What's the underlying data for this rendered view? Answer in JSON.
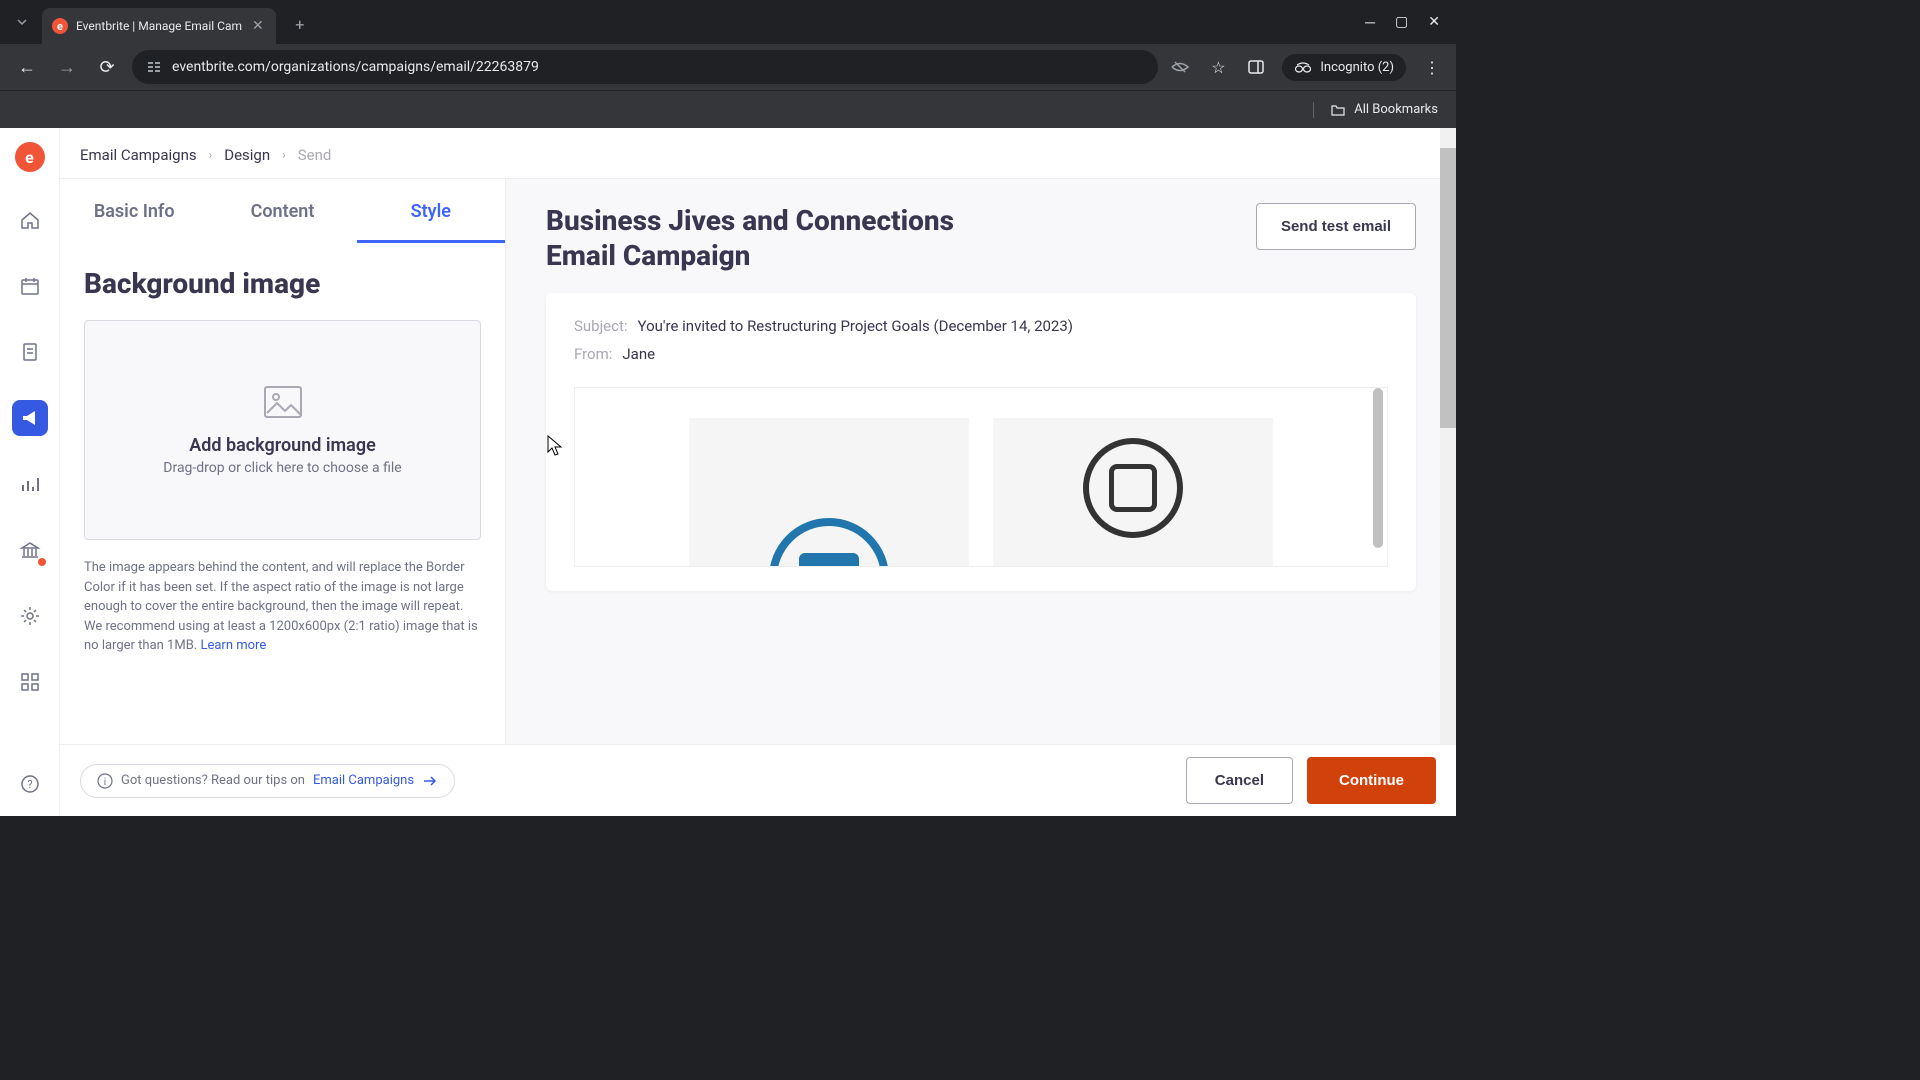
{
  "browser": {
    "tab_title": "Eventbrite | Manage Email Cam",
    "url": "eventbrite.com/organizations/campaigns/email/22263879",
    "incognito": "Incognito (2)",
    "all_bookmarks": "All Bookmarks"
  },
  "breadcrumbs": {
    "item1": "Email Campaigns",
    "item2": "Design",
    "item3": "Send"
  },
  "tabs": {
    "basic": "Basic Info",
    "content": "Content",
    "style": "Style"
  },
  "panel": {
    "heading": "Background image",
    "upload_title": "Add background image",
    "upload_sub": "Drag-drop or click here to choose a file",
    "help_text": "The image appears behind the content, and will replace the Border Color if it has been set. If the aspect ratio of the image is not large enough to cover the entire background, then the image will repeat. We recommend using at least a 1200x600px (2:1 ratio) image that is no larger than 1MB. ",
    "learn_more": "Learn more"
  },
  "preview": {
    "title": "Business Jives and Connections Email Campaign",
    "test_btn": "Send test email",
    "subject_label": "Subject:",
    "subject_value": "You're invited to Restructuring Project Goals (December 14, 2023)",
    "from_label": "From:",
    "from_value": "Jane"
  },
  "footer": {
    "help_text": "Got questions? Read our tips on ",
    "help_link": "Email Campaigns",
    "cancel": "Cancel",
    "continue": "Continue"
  }
}
